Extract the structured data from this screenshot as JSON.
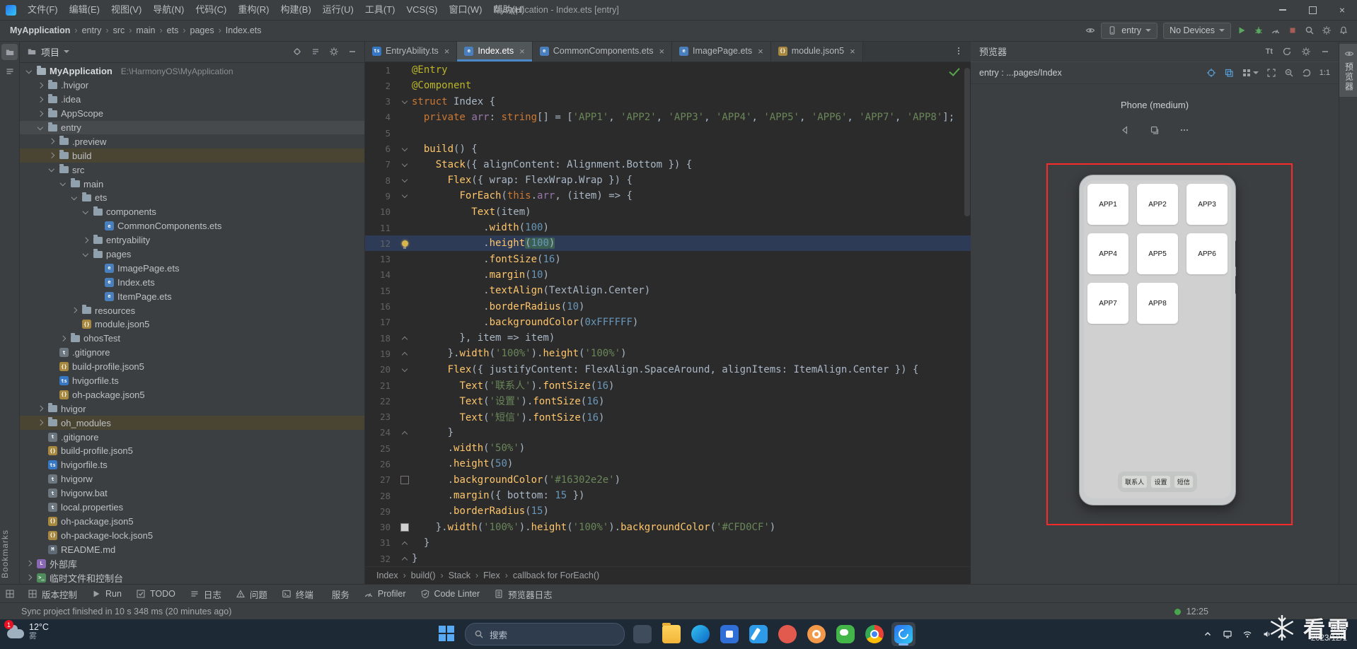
{
  "window": {
    "title": "MyApplication - Index.ets [entry]",
    "menus": [
      "文件(F)",
      "编辑(E)",
      "视图(V)",
      "导航(N)",
      "代码(C)",
      "重构(R)",
      "构建(B)",
      "运行(U)",
      "工具(T)",
      "VCS(S)",
      "窗口(W)",
      "帮助(H)"
    ]
  },
  "toolbar": {
    "breadcrumb": [
      "MyApplication",
      "entry",
      "src",
      "main",
      "ets",
      "pages",
      "Index.ets"
    ],
    "module_select": "entry",
    "device_select": "No Devices",
    "left_icon": "device-preview",
    "right_icons": [
      "run",
      "debug",
      "profiler",
      "stop",
      "search",
      "settings",
      "notifications"
    ]
  },
  "project": {
    "panel_title": "项目",
    "header_icons": [
      "locate",
      "collapse-all",
      "settings",
      "hide"
    ],
    "tree": [
      {
        "label": "MyApplication",
        "hint": "E:\\HarmonyOS\\MyApplication",
        "d": 0,
        "arrow": "open",
        "icon": "project",
        "root": true
      },
      {
        "label": ".hvigor",
        "d": 1,
        "arrow": "closed",
        "icon": "folder"
      },
      {
        "label": ".idea",
        "d": 1,
        "arrow": "closed",
        "icon": "folder"
      },
      {
        "label": "AppScope",
        "d": 1,
        "arrow": "closed",
        "icon": "folder"
      },
      {
        "label": "entry",
        "d": 1,
        "arrow": "open",
        "icon": "folder",
        "hl": "sel"
      },
      {
        "label": ".preview",
        "d": 2,
        "arrow": "closed",
        "icon": "folder"
      },
      {
        "label": "build",
        "d": 2,
        "arrow": "closed",
        "icon": "folder",
        "hl": "olive"
      },
      {
        "label": "src",
        "d": 2,
        "arrow": "open",
        "icon": "folder"
      },
      {
        "label": "main",
        "d": 3,
        "arrow": "open",
        "icon": "folder"
      },
      {
        "label": "ets",
        "d": 4,
        "arrow": "open",
        "icon": "folder"
      },
      {
        "label": "components",
        "d": 5,
        "arrow": "open",
        "icon": "folder"
      },
      {
        "label": "CommonComponents.ets",
        "d": 6,
        "icon": "ets"
      },
      {
        "label": "entryability",
        "d": 5,
        "arrow": "closed",
        "icon": "folder"
      },
      {
        "label": "pages",
        "d": 5,
        "arrow": "open",
        "icon": "folder"
      },
      {
        "label": "ImagePage.ets",
        "d": 6,
        "icon": "ets"
      },
      {
        "label": "Index.ets",
        "d": 6,
        "icon": "ets"
      },
      {
        "label": "ItemPage.ets",
        "d": 6,
        "icon": "ets"
      },
      {
        "label": "resources",
        "d": 4,
        "arrow": "closed",
        "icon": "folder"
      },
      {
        "label": "module.json5",
        "d": 4,
        "icon": "json"
      },
      {
        "label": "ohosTest",
        "d": 3,
        "arrow": "closed",
        "icon": "folder"
      },
      {
        "label": ".gitignore",
        "d": 2,
        "icon": "text"
      },
      {
        "label": "build-profile.json5",
        "d": 2,
        "icon": "json"
      },
      {
        "label": "hvigorfile.ts",
        "d": 2,
        "icon": "ts"
      },
      {
        "label": "oh-package.json5",
        "d": 2,
        "icon": "json"
      },
      {
        "label": "hvigor",
        "d": 1,
        "arrow": "closed",
        "icon": "folder"
      },
      {
        "label": "oh_modules",
        "d": 1,
        "arrow": "closed",
        "icon": "folder",
        "hl": "olive"
      },
      {
        "label": ".gitignore",
        "d": 1,
        "icon": "text"
      },
      {
        "label": "build-profile.json5",
        "d": 1,
        "icon": "json"
      },
      {
        "label": "hvigorfile.ts",
        "d": 1,
        "icon": "ts"
      },
      {
        "label": "hvigorw",
        "d": 1,
        "icon": "text"
      },
      {
        "label": "hvigorw.bat",
        "d": 1,
        "icon": "text"
      },
      {
        "label": "local.properties",
        "d": 1,
        "icon": "text"
      },
      {
        "label": "oh-package.json5",
        "d": 1,
        "icon": "json"
      },
      {
        "label": "oh-package-lock.json5",
        "d": 1,
        "icon": "json"
      },
      {
        "label": "README.md",
        "d": 1,
        "icon": "md"
      },
      {
        "label": "外部库",
        "d": 0,
        "arrow": "closed",
        "icon": "lib"
      },
      {
        "label": "临时文件和控制台",
        "d": 0,
        "arrow": "closed",
        "icon": "console"
      }
    ]
  },
  "tabs": [
    {
      "label": "EntryAbility.ts",
      "icon": "ts",
      "active": false
    },
    {
      "label": "Index.ets",
      "icon": "ets",
      "active": true
    },
    {
      "label": "CommonComponents.ets",
      "icon": "ets",
      "active": false
    },
    {
      "label": "ImagePage.ets",
      "icon": "ets",
      "active": false
    },
    {
      "label": "module.json5",
      "icon": "json",
      "active": false
    }
  ],
  "editor": {
    "breadcrumb": [
      "Index",
      "build()",
      "Stack",
      "Flex",
      "callback for ForEach()"
    ],
    "lines": [
      {
        "n": 1,
        "segs": [
          [
            "a",
            "@Entry"
          ]
        ]
      },
      {
        "n": 2,
        "segs": [
          [
            "a",
            "@Component"
          ]
        ]
      },
      {
        "n": 3,
        "fold": "d",
        "segs": [
          [
            "k",
            "struct"
          ],
          [
            "p",
            " Index {"
          ]
        ]
      },
      {
        "n": 4,
        "segs": [
          [
            "p",
            "  "
          ],
          [
            "k",
            "private"
          ],
          [
            "p",
            " "
          ],
          [
            "d",
            "arr"
          ],
          [
            "p",
            ": "
          ],
          [
            "k",
            "string"
          ],
          [
            "p",
            "[] = ["
          ],
          [
            "s",
            "'APP1'"
          ],
          [
            "p",
            ", "
          ],
          [
            "s",
            "'APP2'"
          ],
          [
            "p",
            ", "
          ],
          [
            "s",
            "'APP3'"
          ],
          [
            "p",
            ", "
          ],
          [
            "s",
            "'APP4'"
          ],
          [
            "p",
            ", "
          ],
          [
            "s",
            "'APP5'"
          ],
          [
            "p",
            ", "
          ],
          [
            "s",
            "'APP6'"
          ],
          [
            "p",
            ", "
          ],
          [
            "s",
            "'APP7'"
          ],
          [
            "p",
            ", "
          ],
          [
            "s",
            "'APP8'"
          ],
          [
            "p",
            "];"
          ]
        ]
      },
      {
        "n": 5,
        "segs": []
      },
      {
        "n": 6,
        "fold": "d",
        "segs": [
          [
            "p",
            "  "
          ],
          [
            "f",
            "build"
          ],
          [
            "p",
            "() {"
          ]
        ]
      },
      {
        "n": 7,
        "fold": "d",
        "segs": [
          [
            "p",
            "    "
          ],
          [
            "f",
            "Stack"
          ],
          [
            "p",
            "({ alignContent: Alignment.Bottom }) {"
          ]
        ]
      },
      {
        "n": 8,
        "fold": "d",
        "segs": [
          [
            "p",
            "      "
          ],
          [
            "f",
            "Flex"
          ],
          [
            "p",
            "({ wrap: FlexWrap.Wrap }) {"
          ]
        ]
      },
      {
        "n": 9,
        "fold": "d",
        "segs": [
          [
            "p",
            "        "
          ],
          [
            "f",
            "ForEach"
          ],
          [
            "p",
            "("
          ],
          [
            "k",
            "this"
          ],
          [
            "p",
            "."
          ],
          [
            "d",
            "arr"
          ],
          [
            "p",
            ", (item) => {"
          ]
        ]
      },
      {
        "n": 10,
        "segs": [
          [
            "p",
            "          "
          ],
          [
            "f",
            "Text"
          ],
          [
            "p",
            "(item)"
          ]
        ]
      },
      {
        "n": 11,
        "segs": [
          [
            "p",
            "            ."
          ],
          [
            "f",
            "width"
          ],
          [
            "p",
            "("
          ],
          [
            "n",
            "100"
          ],
          [
            "p",
            ")"
          ]
        ]
      },
      {
        "n": 12,
        "bulb": true,
        "active": true,
        "segs": [
          [
            "p",
            "            ."
          ],
          [
            "f",
            "height"
          ],
          [
            "p sel",
            "("
          ],
          [
            "n sel",
            "100"
          ],
          [
            "p sel",
            ")"
          ]
        ]
      },
      {
        "n": 13,
        "segs": [
          [
            "p",
            "            ."
          ],
          [
            "f",
            "fontSize"
          ],
          [
            "p",
            "("
          ],
          [
            "n",
            "16"
          ],
          [
            "p",
            ")"
          ]
        ]
      },
      {
        "n": 14,
        "segs": [
          [
            "p",
            "            ."
          ],
          [
            "f",
            "margin"
          ],
          [
            "p",
            "("
          ],
          [
            "n",
            "10"
          ],
          [
            "p",
            ")"
          ]
        ]
      },
      {
        "n": 15,
        "segs": [
          [
            "p",
            "            ."
          ],
          [
            "f",
            "textAlign"
          ],
          [
            "p",
            "(TextAlign.Center)"
          ]
        ]
      },
      {
        "n": 16,
        "segs": [
          [
            "p",
            "            ."
          ],
          [
            "f",
            "borderRadius"
          ],
          [
            "p",
            "("
          ],
          [
            "n",
            "10"
          ],
          [
            "p",
            ")"
          ]
        ]
      },
      {
        "n": 17,
        "segs": [
          [
            "p",
            "            ."
          ],
          [
            "f",
            "backgroundColor"
          ],
          [
            "p",
            "("
          ],
          [
            "n",
            "0xFFFFFF"
          ],
          [
            "p",
            ")"
          ]
        ]
      },
      {
        "n": 18,
        "fold": "u",
        "segs": [
          [
            "p",
            "        }, item => item)"
          ]
        ]
      },
      {
        "n": 19,
        "fold": "u",
        "segs": [
          [
            "p",
            "      }."
          ],
          [
            "f",
            "width"
          ],
          [
            "p",
            "("
          ],
          [
            "s",
            "'100%'"
          ],
          [
            "p",
            ")."
          ],
          [
            "f",
            "height"
          ],
          [
            "p",
            "("
          ],
          [
            "s",
            "'100%'"
          ],
          [
            "p",
            ")"
          ]
        ]
      },
      {
        "n": 20,
        "fold": "d",
        "segs": [
          [
            "p",
            "      "
          ],
          [
            "f",
            "Flex"
          ],
          [
            "p",
            "({ justifyContent: FlexAlign.SpaceAround, alignItems: ItemAlign.Center }) {"
          ]
        ]
      },
      {
        "n": 21,
        "segs": [
          [
            "p",
            "        "
          ],
          [
            "f",
            "Text"
          ],
          [
            "p",
            "("
          ],
          [
            "s",
            "'联系人'"
          ],
          [
            "p",
            ")."
          ],
          [
            "f",
            "fontSize"
          ],
          [
            "p",
            "("
          ],
          [
            "n",
            "16"
          ],
          [
            "p",
            ")"
          ]
        ]
      },
      {
        "n": 22,
        "segs": [
          [
            "p",
            "        "
          ],
          [
            "f",
            "Text"
          ],
          [
            "p",
            "("
          ],
          [
            "s",
            "'设置'"
          ],
          [
            "p",
            ")."
          ],
          [
            "f",
            "fontSize"
          ],
          [
            "p",
            "("
          ],
          [
            "n",
            "16"
          ],
          [
            "p",
            ")"
          ]
        ]
      },
      {
        "n": 23,
        "segs": [
          [
            "p",
            "        "
          ],
          [
            "f",
            "Text"
          ],
          [
            "p",
            "("
          ],
          [
            "s",
            "'短信'"
          ],
          [
            "p",
            ")."
          ],
          [
            "f",
            "fontSize"
          ],
          [
            "p",
            "("
          ],
          [
            "n",
            "16"
          ],
          [
            "p",
            ")"
          ]
        ]
      },
      {
        "n": 24,
        "fold": "u",
        "segs": [
          [
            "p",
            "      }"
          ]
        ]
      },
      {
        "n": 25,
        "segs": [
          [
            "p",
            "      ."
          ],
          [
            "f",
            "width"
          ],
          [
            "p",
            "("
          ],
          [
            "s",
            "'50%'"
          ],
          [
            "p",
            ")"
          ]
        ]
      },
      {
        "n": 26,
        "segs": [
          [
            "p",
            "      ."
          ],
          [
            "f",
            "height"
          ],
          [
            "p",
            "("
          ],
          [
            "n",
            "50"
          ],
          [
            "p",
            ")"
          ]
        ]
      },
      {
        "n": 27,
        "swatch": "#2c2a2a",
        "segs": [
          [
            "p",
            "      ."
          ],
          [
            "f",
            "backgroundColor"
          ],
          [
            "p",
            "("
          ],
          [
            "s",
            "'#16302e2e'"
          ],
          [
            "p",
            ")"
          ]
        ]
      },
      {
        "n": 28,
        "segs": [
          [
            "p",
            "      ."
          ],
          [
            "f",
            "margin"
          ],
          [
            "p",
            "({ bottom: "
          ],
          [
            "n",
            "15"
          ],
          [
            "p",
            " })"
          ]
        ]
      },
      {
        "n": 29,
        "segs": [
          [
            "p",
            "      ."
          ],
          [
            "f",
            "borderRadius"
          ],
          [
            "p",
            "("
          ],
          [
            "n",
            "15"
          ],
          [
            "p",
            ")"
          ]
        ]
      },
      {
        "n": 30,
        "swatch": "#CFD0CF",
        "segs": [
          [
            "p",
            "    }."
          ],
          [
            "f",
            "width"
          ],
          [
            "p",
            "("
          ],
          [
            "s",
            "'100%'"
          ],
          [
            "p",
            ")."
          ],
          [
            "f",
            "height"
          ],
          [
            "p",
            "("
          ],
          [
            "s",
            "'100%'"
          ],
          [
            "p",
            ")."
          ],
          [
            "f",
            "backgroundColor"
          ],
          [
            "p",
            "("
          ],
          [
            "s",
            "'#CFD0CF'"
          ],
          [
            "p",
            ")"
          ]
        ]
      },
      {
        "n": 31,
        "fold": "u",
        "segs": [
          [
            "p",
            "  }"
          ]
        ]
      },
      {
        "n": 32,
        "fold": "u",
        "segs": [
          [
            "p",
            "}"
          ]
        ]
      }
    ]
  },
  "previewer": {
    "title": "预览器",
    "header_icons": [
      "font-size",
      "refresh",
      "settings",
      "hide"
    ],
    "target": "entry : ...pages/Index",
    "subheader_icons": [
      "inspect",
      "component-tree",
      "grid",
      "frame",
      "zoom-out",
      "rotate"
    ],
    "zoom_label": "1:1",
    "device_label": "Phone (medium)",
    "nav_icons": [
      "back",
      "multitask",
      "more"
    ],
    "apps": [
      "APP1",
      "APP2",
      "APP3",
      "APP4",
      "APP5",
      "APP6",
      "APP7",
      "APP8"
    ],
    "dock": [
      "联系人",
      "设置",
      "短信"
    ]
  },
  "tool_windows": {
    "left_bottom": "Bookmarks",
    "right_top": "预览器",
    "bottom": [
      {
        "icon": "vcs",
        "label": "版本控制"
      },
      {
        "icon": "run",
        "label": "Run"
      },
      {
        "icon": "todo",
        "label": "TODO"
      },
      {
        "icon": "log",
        "label": "日志"
      },
      {
        "icon": "problems",
        "label": "问题"
      },
      {
        "icon": "terminal",
        "label": "终端"
      },
      {
        "icon": "services",
        "label": "服务"
      },
      {
        "icon": "profiler",
        "label": "Profiler"
      },
      {
        "icon": "lint",
        "label": "Code Linter"
      },
      {
        "icon": "preview-log",
        "label": "预览器日志"
      }
    ]
  },
  "status_bar": {
    "message": "Sync project finished in 10 s 348 ms (20 minutes ago)",
    "caret": "12:25"
  },
  "taskbar": {
    "badge": "1",
    "weather_temp": "12°C",
    "weather_desc": "雾",
    "search_placeholder": "搜索",
    "apps": [
      "widgets",
      "explorer",
      "edge",
      "store",
      "vscode",
      "mail",
      "photos",
      "wechat",
      "chrome",
      "deveco"
    ],
    "active_app": "deveco",
    "tray_icons": [
      "tray-expand",
      "display",
      "network",
      "volume"
    ],
    "time": "8:53",
    "date": "2023/12/1"
  },
  "watermark": "看雪"
}
